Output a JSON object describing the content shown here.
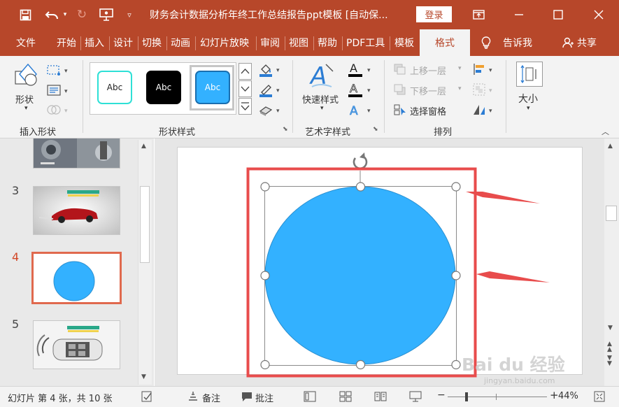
{
  "titlebar": {
    "title": "财务会计数据分析年终工作总结报告ppt模板 [自动保...",
    "login": "登录"
  },
  "tabs": [
    "文件",
    "开始",
    "插入",
    "设计",
    "切换",
    "动画",
    "幻灯片放映",
    "审阅",
    "视图",
    "帮助",
    "PDF工具",
    "模板"
  ],
  "active_tab": "格式",
  "tell_me": "告诉我",
  "share": "共享",
  "ribbon": {
    "insert_shapes": {
      "shape_label": "形状",
      "group_label": "插入形状"
    },
    "shape_styles": {
      "sample_text": "Abc",
      "group_label": "形状样式"
    },
    "wordart": {
      "quick_styles": "快速样式",
      "group_label": "艺术字样式"
    },
    "arrange": {
      "bring_forward": "上移一层",
      "send_backward": "下移一层",
      "selection_pane": "选择窗格",
      "group_label": "排列"
    },
    "size": {
      "label": "大小"
    }
  },
  "slides": [
    {
      "number": "3"
    },
    {
      "number": "4",
      "selected": true
    },
    {
      "number": "5"
    }
  ],
  "status": {
    "slide_info": "幻灯片 第 4 张，共 10 张",
    "notes": "备注",
    "comments": "批注",
    "zoom": "44%"
  },
  "watermark": {
    "main": "Bai du 经验",
    "sub": "jingyan.baidu.com"
  },
  "colors": {
    "brand": "#b7472a",
    "shape_fill": "#33b1ff",
    "highlight": "#e84c4c",
    "selected_thumb_border": "#e0694e"
  }
}
